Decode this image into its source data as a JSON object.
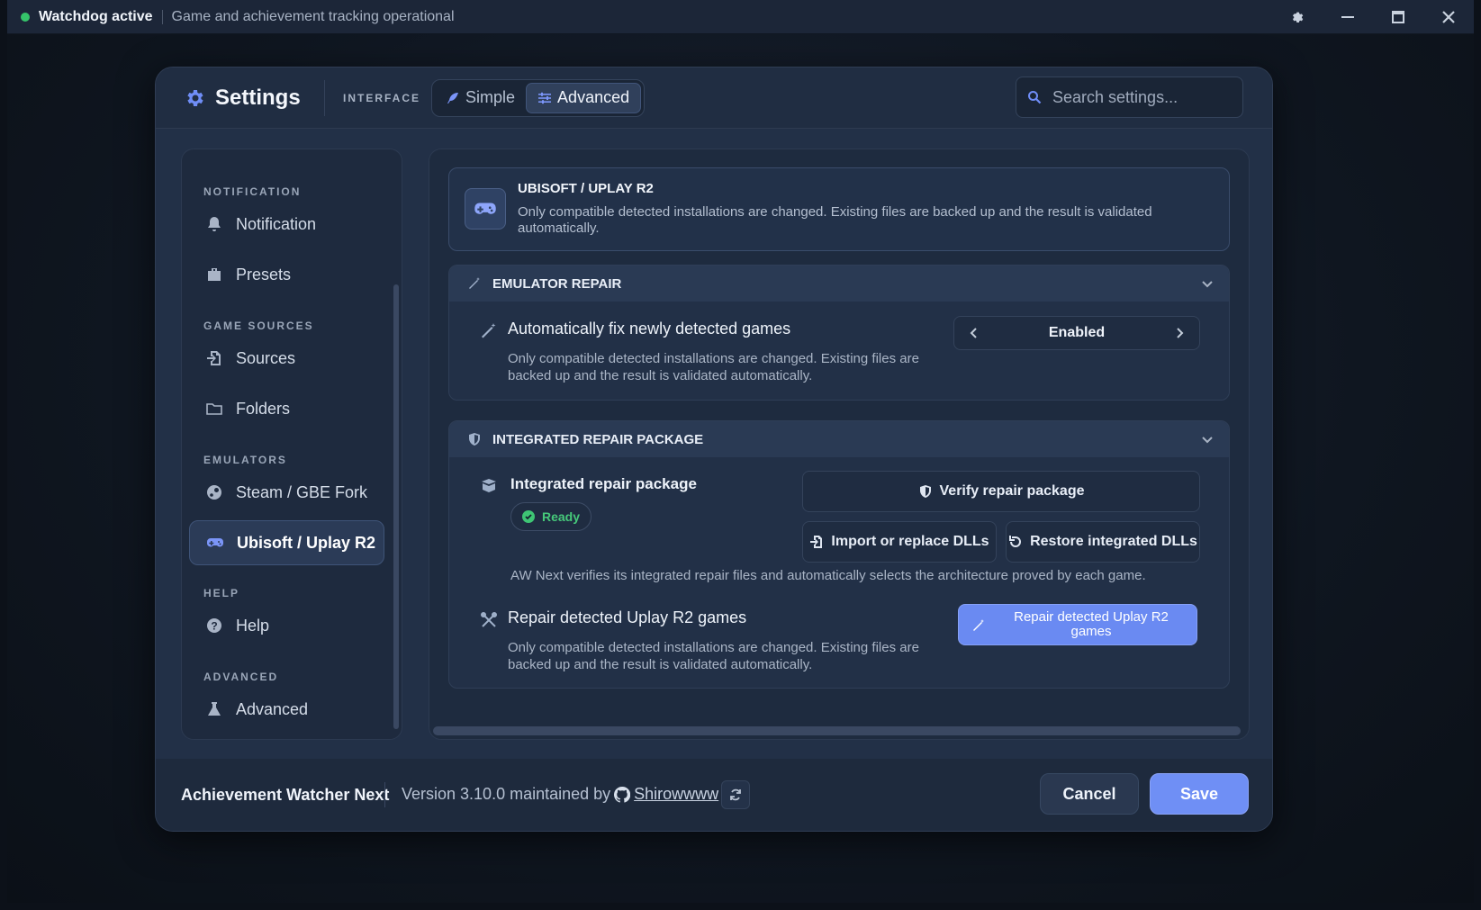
{
  "titlebar": {
    "status": "Watchdog active",
    "subtitle": "Game and achievement tracking operational"
  },
  "header": {
    "title": "Settings",
    "interface_label": "INTERFACE",
    "modes": [
      {
        "label": "Simple",
        "active": false
      },
      {
        "label": "Advanced",
        "active": true
      }
    ],
    "search_placeholder": "Search settings..."
  },
  "sidebar": {
    "sections": [
      {
        "title": "NOTIFICATION",
        "items": [
          {
            "label": "Notification",
            "icon": "bell-icon"
          },
          {
            "label": "Presets",
            "icon": "briefcase-icon"
          }
        ]
      },
      {
        "title": "GAME SOURCES",
        "items": [
          {
            "label": "Sources",
            "icon": "file-import-icon"
          },
          {
            "label": "Folders",
            "icon": "folder-icon"
          }
        ]
      },
      {
        "title": "EMULATORS",
        "items": [
          {
            "label": "Steam / GBE Fork",
            "icon": "steam-icon"
          },
          {
            "label": "Ubisoft / Uplay R2",
            "icon": "gamepad-icon",
            "active": true
          }
        ]
      },
      {
        "title": "HELP",
        "items": [
          {
            "label": "Help",
            "icon": "question-icon"
          }
        ]
      },
      {
        "title": "ADVANCED",
        "items": [
          {
            "label": "Advanced",
            "icon": "flask-icon"
          }
        ]
      }
    ]
  },
  "hero": {
    "title": "UBISOFT / UPLAY R2",
    "description": "Only compatible detected installations are changed. Existing files are backed up and the result is validated automatically."
  },
  "emulator_repair": {
    "heading": "EMULATOR REPAIR",
    "row_title": "Automatically fix newly detected games",
    "row_desc": "Only compatible detected installations are changed. Existing files are backed up and the result is validated automatically.",
    "value": "Enabled"
  },
  "integrated": {
    "heading": "INTEGRATED REPAIR PACKAGE",
    "package_title": "Integrated repair package",
    "status": "Ready",
    "verify_label": "Verify repair package",
    "import_label": "Import or replace DLLs",
    "restore_label": "Restore integrated DLLs",
    "note": "AW Next verifies its integrated repair files and automatically selects the architecture proved by each game.",
    "repair_title": "Repair detected Uplay R2 games",
    "repair_desc": "Only compatible detected installations are changed. Existing files are backed up and the result is validated automatically.",
    "repair_button": "Repair detected Uplay R2 games"
  },
  "footer": {
    "app_name": "Achievement Watcher Next",
    "version_text": "Version 3.10.0 maintained by",
    "author": "Shirowwww",
    "cancel": "Cancel",
    "save": "Save"
  },
  "colors": {
    "accent": "#6f8ff5",
    "status_ok": "#35c46a"
  }
}
